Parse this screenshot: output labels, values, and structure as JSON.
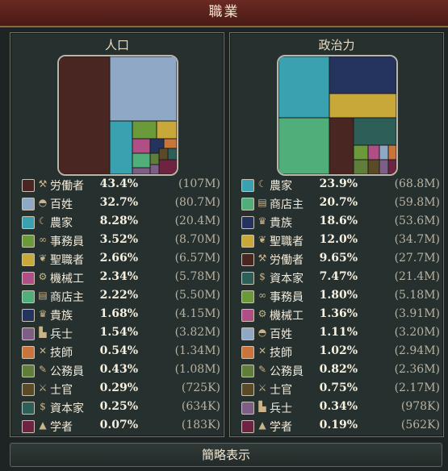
{
  "window": {
    "title": "職業"
  },
  "left": {
    "title": "人口",
    "rows": [
      {
        "icon": "shovel-icon",
        "name": "労働者",
        "pct": "43.4%",
        "abs": "(107M)",
        "color": "#4a2622"
      },
      {
        "icon": "hat-icon",
        "name": "百姓",
        "pct": "32.7%",
        "abs": "(80.7M)",
        "color": "#8fa8c6"
      },
      {
        "icon": "sickle-icon",
        "name": "農家",
        "pct": "8.28%",
        "abs": "(20.4M)",
        "color": "#3aa1b0"
      },
      {
        "icon": "glasses-icon",
        "name": "事務員",
        "pct": "3.52%",
        "abs": "(8.70M)",
        "color": "#6a9a3a"
      },
      {
        "icon": "wings-icon",
        "name": "聖職者",
        "pct": "2.66%",
        "abs": "(6.57M)",
        "color": "#c9a83a"
      },
      {
        "icon": "wrench-icon",
        "name": "機械工",
        "pct": "2.34%",
        "abs": "(5.78M)",
        "color": "#b04f86"
      },
      {
        "icon": "book-icon",
        "name": "商店主",
        "pct": "2.22%",
        "abs": "(5.50M)",
        "color": "#4fae7a"
      },
      {
        "icon": "crown-icon",
        "name": "貴族",
        "pct": "1.68%",
        "abs": "(4.15M)",
        "color": "#24345e"
      },
      {
        "icon": "boot-icon",
        "name": "兵士",
        "pct": "1.54%",
        "abs": "(3.82M)",
        "color": "#7e5e86"
      },
      {
        "icon": "tools-icon",
        "name": "技師",
        "pct": "0.54%",
        "abs": "(1.34M)",
        "color": "#c8743a"
      },
      {
        "icon": "quill-icon",
        "name": "公務員",
        "pct": "0.43%",
        "abs": "(1.08M)",
        "color": "#5e7e3a"
      },
      {
        "icon": "officer-icon",
        "name": "士官",
        "pct": "0.29%",
        "abs": "(725K)",
        "color": "#5a4a28"
      },
      {
        "icon": "moneybag-icon",
        "name": "資本家",
        "pct": "0.25%",
        "abs": "(634K)",
        "color": "#2e5e58"
      },
      {
        "icon": "gradcap-icon",
        "name": "学者",
        "pct": "0.07%",
        "abs": "(183K)",
        "color": "#6e2440"
      }
    ]
  },
  "right": {
    "title": "政治力",
    "rows": [
      {
        "icon": "sickle-icon",
        "name": "農家",
        "pct": "23.9%",
        "abs": "(68.8M)",
        "color": "#3aa1b0"
      },
      {
        "icon": "book-icon",
        "name": "商店主",
        "pct": "20.7%",
        "abs": "(59.8M)",
        "color": "#4fae7a"
      },
      {
        "icon": "crown-icon",
        "name": "貴族",
        "pct": "18.6%",
        "abs": "(53.6M)",
        "color": "#24345e"
      },
      {
        "icon": "wings-icon",
        "name": "聖職者",
        "pct": "12.0%",
        "abs": "(34.7M)",
        "color": "#c9a83a"
      },
      {
        "icon": "shovel-icon",
        "name": "労働者",
        "pct": "9.65%",
        "abs": "(27.7M)",
        "color": "#4a2622"
      },
      {
        "icon": "moneybag-icon",
        "name": "資本家",
        "pct": "7.47%",
        "abs": "(21.4M)",
        "color": "#2e5e58"
      },
      {
        "icon": "glasses-icon",
        "name": "事務員",
        "pct": "1.80%",
        "abs": "(5.18M)",
        "color": "#6a9a3a"
      },
      {
        "icon": "wrench-icon",
        "name": "機械工",
        "pct": "1.36%",
        "abs": "(3.91M)",
        "color": "#b04f86"
      },
      {
        "icon": "hat-icon",
        "name": "百姓",
        "pct": "1.11%",
        "abs": "(3.20M)",
        "color": "#8fa8c6"
      },
      {
        "icon": "tools-icon",
        "name": "技師",
        "pct": "1.02%",
        "abs": "(2.94M)",
        "color": "#c8743a"
      },
      {
        "icon": "quill-icon",
        "name": "公務員",
        "pct": "0.82%",
        "abs": "(2.36M)",
        "color": "#5e7e3a"
      },
      {
        "icon": "officer-icon",
        "name": "士官",
        "pct": "0.75%",
        "abs": "(2.17M)",
        "color": "#5a4a28"
      },
      {
        "icon": "boot-icon",
        "name": "兵士",
        "pct": "0.34%",
        "abs": "(978K)",
        "color": "#7e5e86"
      },
      {
        "icon": "gradcap-icon",
        "name": "学者",
        "pct": "0.19%",
        "abs": "(562K)",
        "color": "#6e2440"
      }
    ]
  },
  "footer": {
    "button_label": "簡略表示"
  }
}
